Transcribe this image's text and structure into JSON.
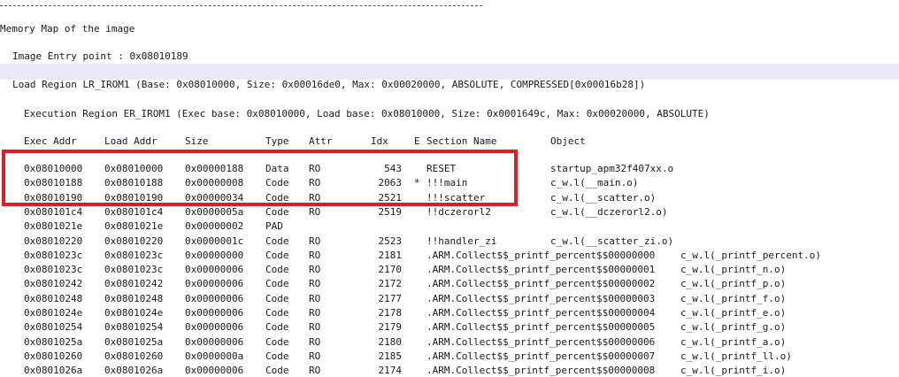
{
  "header": {
    "divider": "---------------------------------------------------------------------",
    "title": "Memory Map of the image",
    "entry_point": "Image Entry point : 0x08010189",
    "load_region": "Load Region LR_IROM1 (Base: 0x08010000, Size: 0x00016de0, Max: 0x00020000, ABSOLUTE, COMPRESSED[0x00016b28])",
    "exec_region": "Execution Region ER_IROM1 (Exec base: 0x08010000, Load base: 0x08010000, Size: 0x0001649c, Max: 0x00020000, ABSOLUTE)"
  },
  "columns": {
    "exec_addr": "Exec Addr",
    "load_addr": "Load Addr",
    "size": "Size",
    "type": "Type",
    "attr": "Attr",
    "idx": "Idx",
    "e": "E",
    "section": "Section Name",
    "object": "Object"
  },
  "rows": [
    {
      "exec": "0x08010000",
      "load": "0x08010000",
      "size": "0x00000188",
      "type": "Data",
      "attr": "RO",
      "idx": "543",
      "e": "",
      "section": "RESET",
      "object": "startup_apm32f407xx.o"
    },
    {
      "exec": "0x08010188",
      "load": "0x08010188",
      "size": "0x00000008",
      "type": "Code",
      "attr": "RO",
      "idx": "2063",
      "e": "*",
      "section": "!!!main",
      "object": "c_w.l(__main.o)"
    },
    {
      "exec": "0x08010190",
      "load": "0x08010190",
      "size": "0x00000034",
      "type": "Code",
      "attr": "RO",
      "idx": "2521",
      "e": "",
      "section": "!!!scatter",
      "object": "c_w.l(__scatter.o)"
    },
    {
      "exec": "0x080101c4",
      "load": "0x080101c4",
      "size": "0x0000005a",
      "type": "Code",
      "attr": "RO",
      "idx": "2519",
      "e": "",
      "section": "!!dczerorl2",
      "object": "c_w.l(__dczerorl2.o)"
    },
    {
      "exec": "0x0801021e",
      "load": "0x0801021e",
      "size": "0x00000002",
      "type": "PAD",
      "attr": "",
      "idx": "",
      "e": "",
      "section": "",
      "object": ""
    },
    {
      "exec": "0x08010220",
      "load": "0x08010220",
      "size": "0x0000001c",
      "type": "Code",
      "attr": "RO",
      "idx": "2523",
      "e": "",
      "section": "!!handler_zi",
      "object": "c_w.l(__scatter_zi.o)"
    },
    {
      "exec": "0x0801023c",
      "load": "0x0801023c",
      "size": "0x00000000",
      "type": "Code",
      "attr": "RO",
      "idx": "2181",
      "e": "",
      "section": ".ARM.Collect$$_printf_percent$$00000000",
      "object": "c_w.l(_printf_percent.o)"
    },
    {
      "exec": "0x0801023c",
      "load": "0x0801023c",
      "size": "0x00000006",
      "type": "Code",
      "attr": "RO",
      "idx": "2170",
      "e": "",
      "section": ".ARM.Collect$$_printf_percent$$00000001",
      "object": "c_w.l(_printf_n.o)"
    },
    {
      "exec": "0x08010242",
      "load": "0x08010242",
      "size": "0x00000006",
      "type": "Code",
      "attr": "RO",
      "idx": "2172",
      "e": "",
      "section": ".ARM.Collect$$_printf_percent$$00000002",
      "object": "c_w.l(_printf_p.o)"
    },
    {
      "exec": "0x08010248",
      "load": "0x08010248",
      "size": "0x00000006",
      "type": "Code",
      "attr": "RO",
      "idx": "2177",
      "e": "",
      "section": ".ARM.Collect$$_printf_percent$$00000003",
      "object": "c_w.l(_printf_f.o)"
    },
    {
      "exec": "0x0801024e",
      "load": "0x0801024e",
      "size": "0x00000006",
      "type": "Code",
      "attr": "RO",
      "idx": "2178",
      "e": "",
      "section": ".ARM.Collect$$_printf_percent$$00000004",
      "object": "c_w.l(_printf_e.o)"
    },
    {
      "exec": "0x08010254",
      "load": "0x08010254",
      "size": "0x00000006",
      "type": "Code",
      "attr": "RO",
      "idx": "2179",
      "e": "",
      "section": ".ARM.Collect$$_printf_percent$$00000005",
      "object": "c_w.l(_printf_g.o)"
    },
    {
      "exec": "0x0801025a",
      "load": "0x0801025a",
      "size": "0x00000006",
      "type": "Code",
      "attr": "RO",
      "idx": "2180",
      "e": "",
      "section": ".ARM.Collect$$_printf_percent$$00000006",
      "object": "c_w.l(_printf_a.o)"
    },
    {
      "exec": "0x08010260",
      "load": "0x08010260",
      "size": "0x0000000a",
      "type": "Code",
      "attr": "RO",
      "idx": "2185",
      "e": "",
      "section": ".ARM.Collect$$_printf_percent$$00000007",
      "object": "c_w.l(_printf_ll.o)"
    },
    {
      "exec": "0x0801026a",
      "load": "0x0801026a",
      "size": "0x00000006",
      "type": "Code",
      "attr": "RO",
      "idx": "2174",
      "e": "",
      "section": ".ARM.Collect$$_printf_percent$$00000008",
      "object": "c_w.l(_printf_i.o)"
    }
  ],
  "annotation": {
    "highlight_color": "#d62027",
    "row_band_color": "#e8e8f6"
  }
}
